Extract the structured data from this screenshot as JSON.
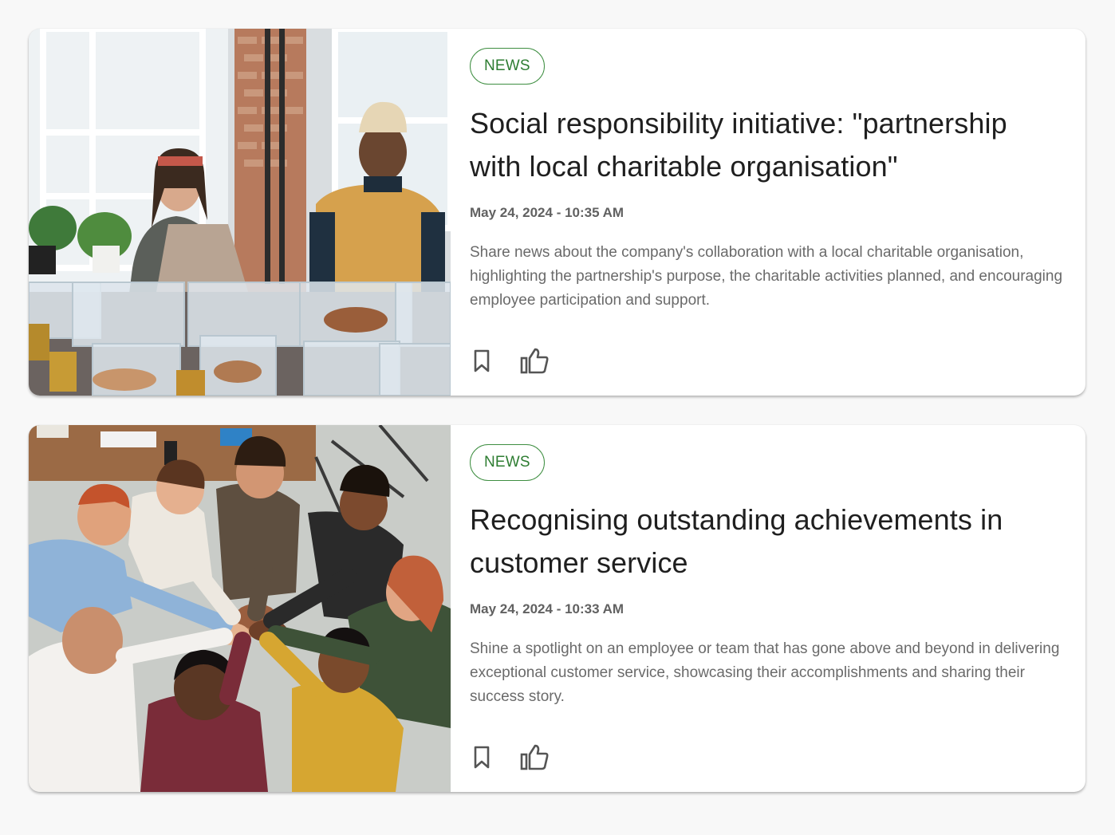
{
  "posts": [
    {
      "tag": "NEWS",
      "title": "Social responsibility initiative: \"partnership with local charitable organisation\"",
      "date": "May 24, 2024 - 10:35 AM",
      "description": "Share news about the company's collaboration with a local charitable organisation, highlighting the partnership's purpose, the charitable activities planned, and encouraging employee participation and support.",
      "image_subject": "volunteers-sorting-donations-photo",
      "icons": [
        "bookmark-icon",
        "thumbs-up-icon"
      ]
    },
    {
      "tag": "NEWS",
      "title": "Recognising outstanding achievements in customer service",
      "date": "May 24, 2024 - 10:33 AM",
      "description": "Shine a spotlight on an employee or team that has gone above and beyond in delivering exceptional customer service, showcasing their accomplishments and sharing their success story.",
      "image_subject": "team-hands-together-photo",
      "icons": [
        "bookmark-icon",
        "thumbs-up-icon"
      ]
    }
  ],
  "colors": {
    "page_background": "#f8f8f8",
    "card_background": "#ffffff",
    "chip_border": "#3e8e41",
    "chip_text": "#2e7d32",
    "title_text": "#1f1f1f",
    "date_text": "#616161",
    "description_text": "#6a6a6a",
    "icon": "#555555"
  }
}
